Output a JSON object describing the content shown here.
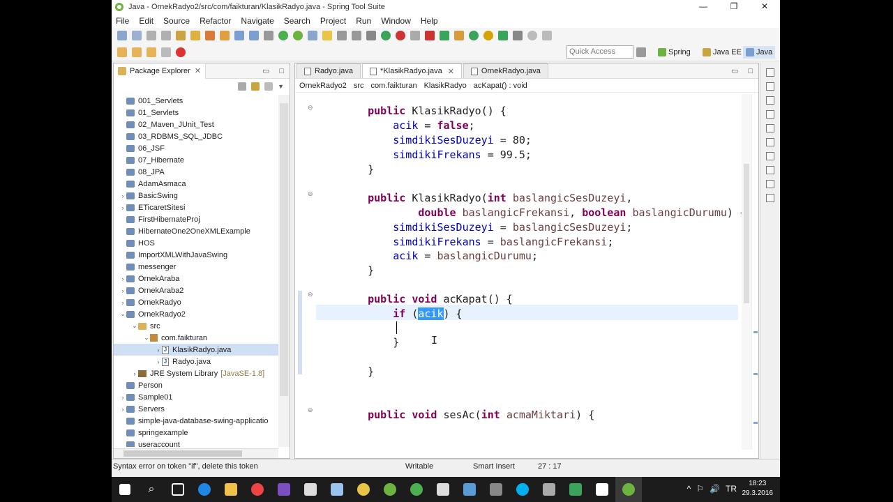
{
  "window": {
    "title": "Java - OrnekRadyo2/src/com/faikturan/KlasikRadyo.java - Spring Tool Suite"
  },
  "menu": [
    "File",
    "Edit",
    "Source",
    "Refactor",
    "Navigate",
    "Search",
    "Project",
    "Run",
    "Window",
    "Help"
  ],
  "quick_access": {
    "placeholder": "Quick Access"
  },
  "perspectives": [
    {
      "label": "Spring",
      "icon": "spring-perspective-icon"
    },
    {
      "label": "Java EE",
      "icon": "javaee-perspective-icon"
    },
    {
      "label": "Java",
      "icon": "java-perspective-icon"
    }
  ],
  "package_explorer": {
    "title": "Package Explorer",
    "items": [
      {
        "label": "001_Servlets",
        "kind": "project",
        "expandable": false,
        "level": 0
      },
      {
        "label": "01_Servlets",
        "kind": "project",
        "expandable": false,
        "level": 0
      },
      {
        "label": "02_Maven_JUnit_Test",
        "kind": "project",
        "expandable": false,
        "level": 0
      },
      {
        "label": "03_RDBMS_SQL_JDBC",
        "kind": "project",
        "expandable": false,
        "level": 0
      },
      {
        "label": "06_JSF",
        "kind": "project",
        "expandable": false,
        "level": 0
      },
      {
        "label": "07_Hibernate",
        "kind": "project",
        "expandable": false,
        "level": 0
      },
      {
        "label": "08_JPA",
        "kind": "project",
        "expandable": false,
        "level": 0
      },
      {
        "label": "AdamAsmaca",
        "kind": "project",
        "expandable": false,
        "level": 0
      },
      {
        "label": "BasicSwing",
        "kind": "project",
        "expandable": true,
        "level": 0
      },
      {
        "label": "ETicaretSitesi",
        "kind": "project",
        "expandable": true,
        "level": 0
      },
      {
        "label": "FirstHibernateProj",
        "kind": "project",
        "expandable": false,
        "level": 0
      },
      {
        "label": "HibernateOne2OneXMLExample",
        "kind": "project",
        "expandable": false,
        "level": 0
      },
      {
        "label": "HOS",
        "kind": "project",
        "expandable": false,
        "level": 0
      },
      {
        "label": "ImportXMLWithJavaSwing",
        "kind": "project",
        "expandable": false,
        "level": 0
      },
      {
        "label": "messenger",
        "kind": "project",
        "expandable": false,
        "level": 0
      },
      {
        "label": "OrnekAraba",
        "kind": "project",
        "expandable": true,
        "level": 0
      },
      {
        "label": "OrnekAraba2",
        "kind": "project",
        "expandable": true,
        "level": 0
      },
      {
        "label": "OrnekRadyo",
        "kind": "project",
        "expandable": true,
        "level": 0
      },
      {
        "label": "OrnekRadyo2",
        "kind": "project",
        "expandable": true,
        "expanded": true,
        "level": 0
      },
      {
        "label": "src",
        "kind": "folder",
        "expandable": true,
        "expanded": true,
        "level": 1
      },
      {
        "label": "com.faikturan",
        "kind": "package",
        "expandable": true,
        "expanded": true,
        "level": 2
      },
      {
        "label": "KlasikRadyo.java",
        "kind": "java",
        "expandable": true,
        "level": 3,
        "selected": true
      },
      {
        "label": "Radyo.java",
        "kind": "java",
        "expandable": true,
        "level": 3
      },
      {
        "label": "JRE System Library",
        "suffix": "[JavaSE-1.8]",
        "kind": "library",
        "expandable": true,
        "level": 1
      },
      {
        "label": "Person",
        "kind": "project",
        "expandable": false,
        "level": 0
      },
      {
        "label": "Sample01",
        "kind": "project",
        "expandable": true,
        "level": 0
      },
      {
        "label": "Servers",
        "kind": "project",
        "expandable": true,
        "level": 0
      },
      {
        "label": "simple-java-database-swing-applicatio",
        "kind": "project",
        "expandable": false,
        "level": 0
      },
      {
        "label": "springexample",
        "kind": "project",
        "expandable": false,
        "level": 0
      },
      {
        "label": "useraccount",
        "kind": "project",
        "expandable": false,
        "level": 0
      }
    ]
  },
  "editor": {
    "tabs": [
      {
        "label": "Radyo.java",
        "active": false
      },
      {
        "label": "*KlasikRadyo.java",
        "active": true
      },
      {
        "label": "OrnekRadyo.java",
        "active": false
      }
    ],
    "breadcrumb": [
      "OrnekRadyo2",
      "src",
      "com.faikturan",
      "KlasikRadyo",
      "acKapat() : void"
    ],
    "code": [
      "    public KlasikRadyo() {",
      "        acik = false;",
      "        simdikiSesDuzeyi = 80;",
      "        simdikiFrekans = 99.5;",
      "    }",
      "",
      "    public KlasikRadyo(int baslangicSesDuzeyi,",
      "            double baslangicFrekansi, boolean baslangicDurumu) {",
      "        simdikiSesDuzeyi = baslangicSesDuzeyi;",
      "        simdikiFrekans = baslangicFrekansi;",
      "        acik = baslangicDurumu;",
      "    }",
      "",
      "    public void acKapat() {",
      "        if (acik) {",
      "",
      "        }",
      "",
      "    }",
      "",
      "",
      "    public void sesAc(int acmaMiktari) {"
    ]
  },
  "status": {
    "message": "Syntax error on token \"if\", delete this token",
    "writable": "Writable",
    "insert_mode": "Smart Insert",
    "position": "27 : 17"
  },
  "taskbar": {
    "time": "18:23",
    "date": "29.3.2016",
    "tray": [
      "^",
      "⚐",
      "🔊",
      "TR"
    ]
  },
  "colors": {
    "keyword": "#7f0055",
    "field": "#0000c0",
    "selection": "#3399ff",
    "current_line": "#e8f2fe"
  }
}
